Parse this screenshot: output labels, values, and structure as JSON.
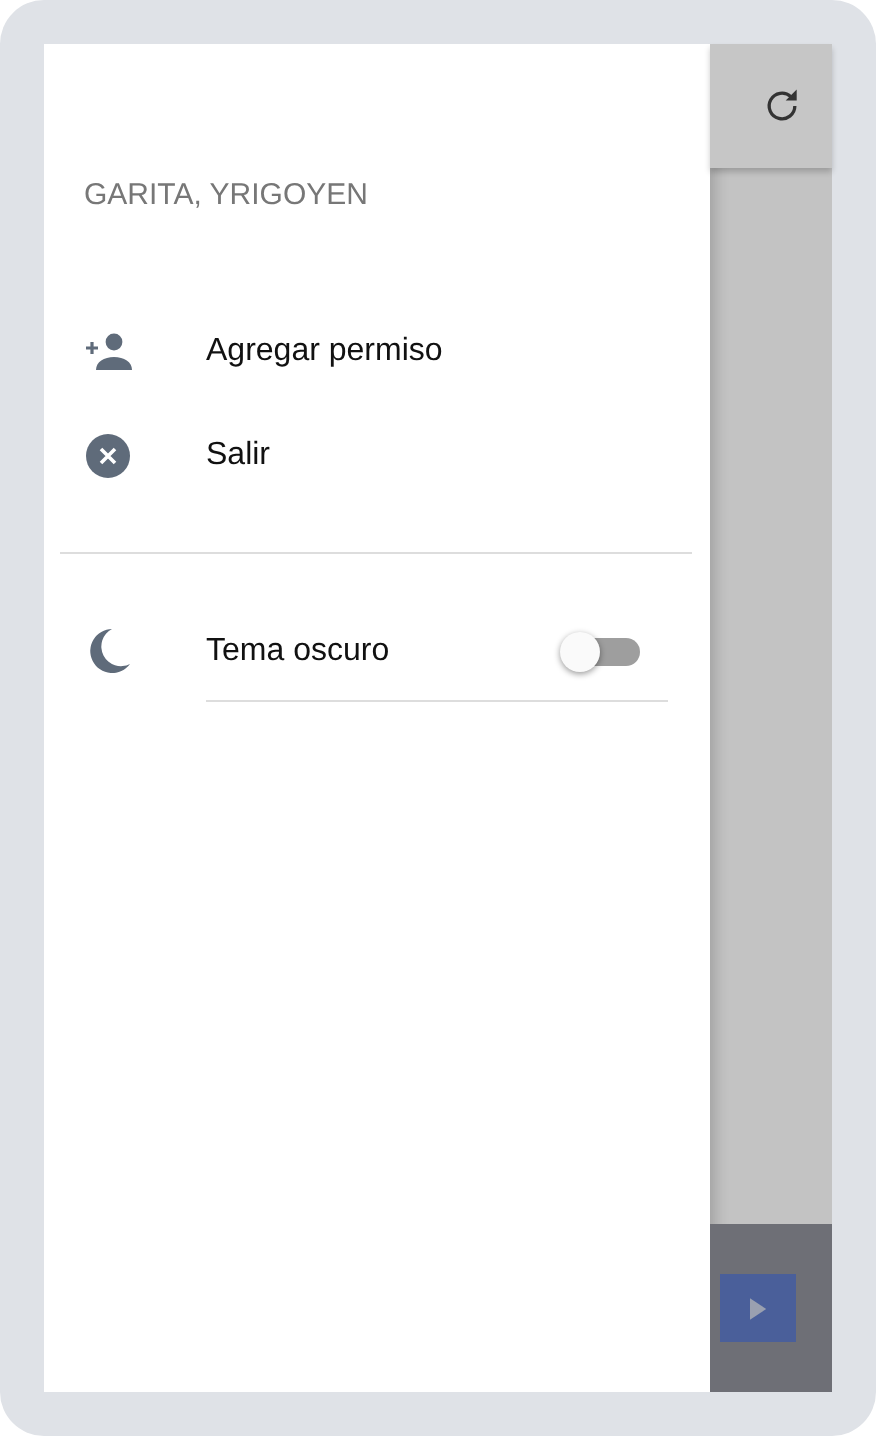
{
  "drawer": {
    "header": "GARITA, YRIGOYEN",
    "items": [
      {
        "kind": "add-user",
        "label": "Agregar permiso"
      },
      {
        "kind": "exit",
        "label": "Salir"
      }
    ],
    "theme_toggle": {
      "label": "Tema oscuro",
      "on": false
    }
  }
}
